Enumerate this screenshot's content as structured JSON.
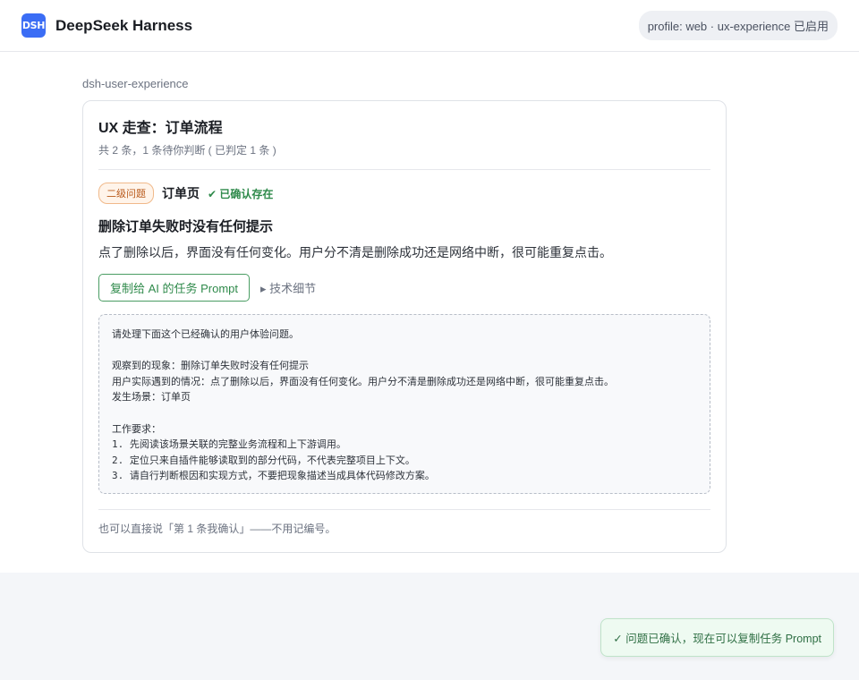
{
  "header": {
    "logo_text": "DSH",
    "app_title": "DeepSeek Harness",
    "profile_status": "profile: web · ux-experience 已启用"
  },
  "skill_label": "dsh-user-experience",
  "card": {
    "title": "UX 走查：订单流程",
    "summary": "共 2 条，1 条待你判断 ( 已判定 1 条 )",
    "issue": {
      "severity": "二级问题",
      "location": "订单页",
      "status": "✔ 已确认存在",
      "title": "删除订单失败时没有任何提示",
      "description": "点了删除以后，界面没有任何变化。用户分不清是删除成功还是网络中断，很可能重复点击。",
      "copy_button": "复制给 AI 的任务 Prompt",
      "tech_details_toggle": "▸ 技术细节",
      "prompt_text": "请处理下面这个已经确认的用户体验问题。\n\n观察到的现象：删除订单失败时没有任何提示\n用户实际遇到的情况：点了删除以后，界面没有任何变化。用户分不清是删除成功还是网络中断，很可能重复点击。\n发生场景：订单页\n\n工作要求：\n1. 先阅读该场景关联的完整业务流程和上下游调用。\n2. 定位只来自插件能够读取到的部分代码，不代表完整项目上下文。\n3. 请自行判断根因和实现方式，不要把现象描述当成具体代码修改方案。"
    },
    "footer_hint": "也可以直接说「第 1 条我确认」——不用记编号。"
  },
  "toast": {
    "message": "✓ 问题已确认，现在可以复制任务 Prompt"
  }
}
